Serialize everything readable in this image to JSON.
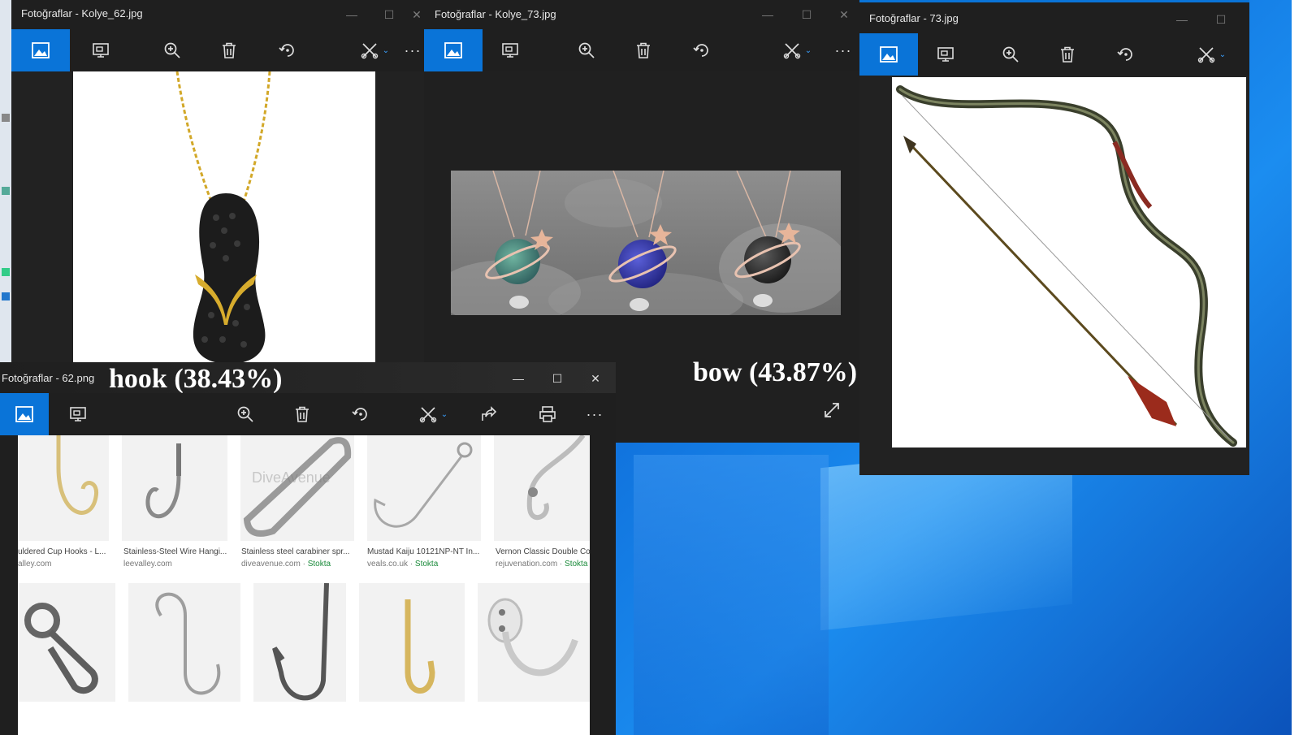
{
  "windows": {
    "w62": {
      "title": "Fotoğraflar - Kolye_62.jpg"
    },
    "w73": {
      "title": "Fotoğraflar - Kolye_73.jpg"
    },
    "wbow": {
      "title": "Fotoğraflar - 73.jpg"
    },
    "whook": {
      "title": "Fotoğraflar - 62.png"
    }
  },
  "labels": {
    "hook": "hook (38.43%)",
    "bow": "bow (43.87%)"
  },
  "controls": {
    "minimize": "—",
    "maximize": "☐",
    "close": "✕",
    "more": "···"
  },
  "icons": [
    "image-icon",
    "slideshow-icon",
    "zoom-in-icon",
    "delete-icon",
    "rotate-icon",
    "edit-icon",
    "share-icon",
    "print-icon",
    "expand-icon"
  ],
  "search_results": {
    "row1": [
      {
        "caption": "uldered Cup Hooks - L...",
        "source": "alley.com",
        "stock": ""
      },
      {
        "caption": "Stainless-Steel Wire Hangi...",
        "source": "leevalley.com",
        "stock": ""
      },
      {
        "caption": "Stainless steel carabiner spr...",
        "source": "diveavenue.com",
        "stock": "Stokta"
      },
      {
        "caption": "Mustad Kaiju 10121NP-NT In...",
        "source": "veals.co.uk",
        "stock": "Stokta"
      },
      {
        "caption": "Vernon Classic Double Co",
        "source": "rejuvenation.com",
        "stock": "Stokta"
      }
    ],
    "watermark": "DiveAvenue"
  },
  "colors": {
    "accent": "#0a74d8",
    "window_bg": "#1f1f1f",
    "stock_green": "#1a8a3a"
  }
}
